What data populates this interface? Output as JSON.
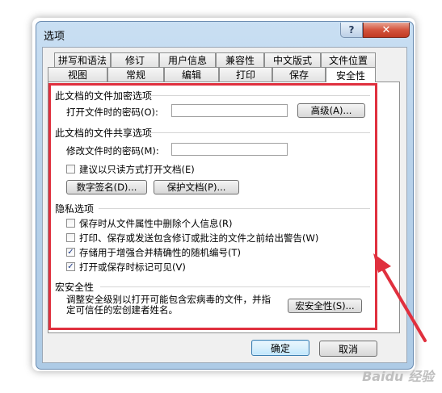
{
  "window": {
    "title": "选项",
    "help_label": "?",
    "close_label": "✕"
  },
  "tabs": {
    "row1": [
      "拼写和语法",
      "修订",
      "用户信息",
      "兼容性",
      "中文版式",
      "文件位置"
    ],
    "row2": [
      "视图",
      "常规",
      "编辑",
      "打印",
      "保存",
      "安全性"
    ],
    "active": "安全性"
  },
  "encryption": {
    "section": "此文档的文件加密选项",
    "open_password_label": "打开文件时的密码(O):",
    "advanced_button": "高级(A)..."
  },
  "sharing": {
    "section": "此文档的文件共享选项",
    "modify_password_label": "修改文件时的密码(M):",
    "readonly_label": "建议以只读方式打开文档(E)",
    "readonly_checked": false,
    "signature_button": "数字签名(D)...",
    "protect_button": "保护文档(P)..."
  },
  "privacy": {
    "section": "隐私选项",
    "options": [
      {
        "label": "保存时从文件属性中删除个人信息(R)",
        "checked": false
      },
      {
        "label": "打印、保存或发送包含修订或批注的文件之前给出警告(W)",
        "checked": false
      },
      {
        "label": "存储用于增强合并精确性的随机编号(T)",
        "checked": true
      },
      {
        "label": "打开或保存时标记可见(V)",
        "checked": true
      }
    ]
  },
  "macro": {
    "section": "宏安全性",
    "description_line1": "调整安全级别以打开可能包含宏病毒的文件，并指",
    "description_line2": "定可信任的宏创建者姓名。",
    "button": "宏安全性(S)..."
  },
  "footer": {
    "ok": "确定",
    "cancel": "取消"
  },
  "watermark": "Baidu 经验",
  "colors": {
    "highlight": "#e0303e",
    "accent": "#3c7fb1"
  }
}
